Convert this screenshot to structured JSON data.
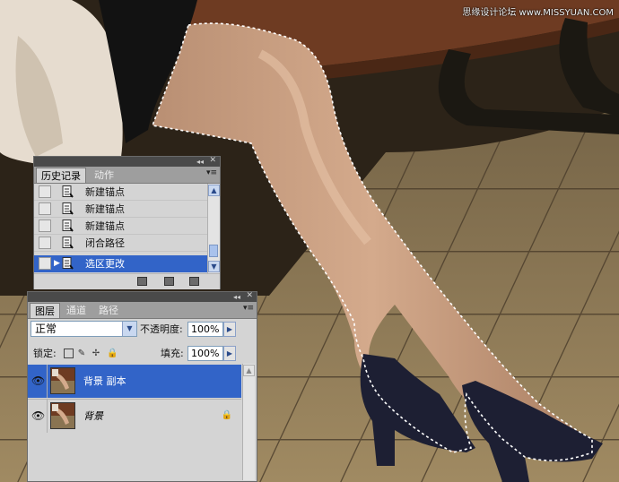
{
  "watermark": "思缘设计论坛 www.MISSYUAN.COM",
  "panel_controls": {
    "collapse": "◂◂",
    "close": "✕",
    "menu": "▾≡"
  },
  "history_panel": {
    "tabs": [
      {
        "label": "历史记录",
        "active": true
      },
      {
        "label": "动作",
        "active": false
      }
    ],
    "items": [
      {
        "label": "新建锚点",
        "selected": false
      },
      {
        "label": "新建锚点",
        "selected": false
      },
      {
        "label": "新建锚点",
        "selected": false
      },
      {
        "label": "闭合路径",
        "selected": false
      },
      {
        "label": "选区更改",
        "selected": true
      }
    ]
  },
  "layers_panel": {
    "tabs": [
      {
        "label": "图层",
        "active": true
      },
      {
        "label": "通道",
        "active": false
      },
      {
        "label": "路径",
        "active": false
      }
    ],
    "blend_mode": "正常",
    "opacity_label": "不透明度:",
    "opacity_value": "100%",
    "lock_label": "锁定:",
    "fill_label": "填充:",
    "fill_value": "100%",
    "layers": [
      {
        "name": "背景 副本",
        "selected": true,
        "visible": true,
        "locked": false
      },
      {
        "name": "背景",
        "selected": false,
        "visible": true,
        "locked": true
      }
    ]
  },
  "colors": {
    "selection": "#3264c8",
    "panel_bg": "#d4d4d4",
    "tab_bar": "#9e9e9e"
  }
}
